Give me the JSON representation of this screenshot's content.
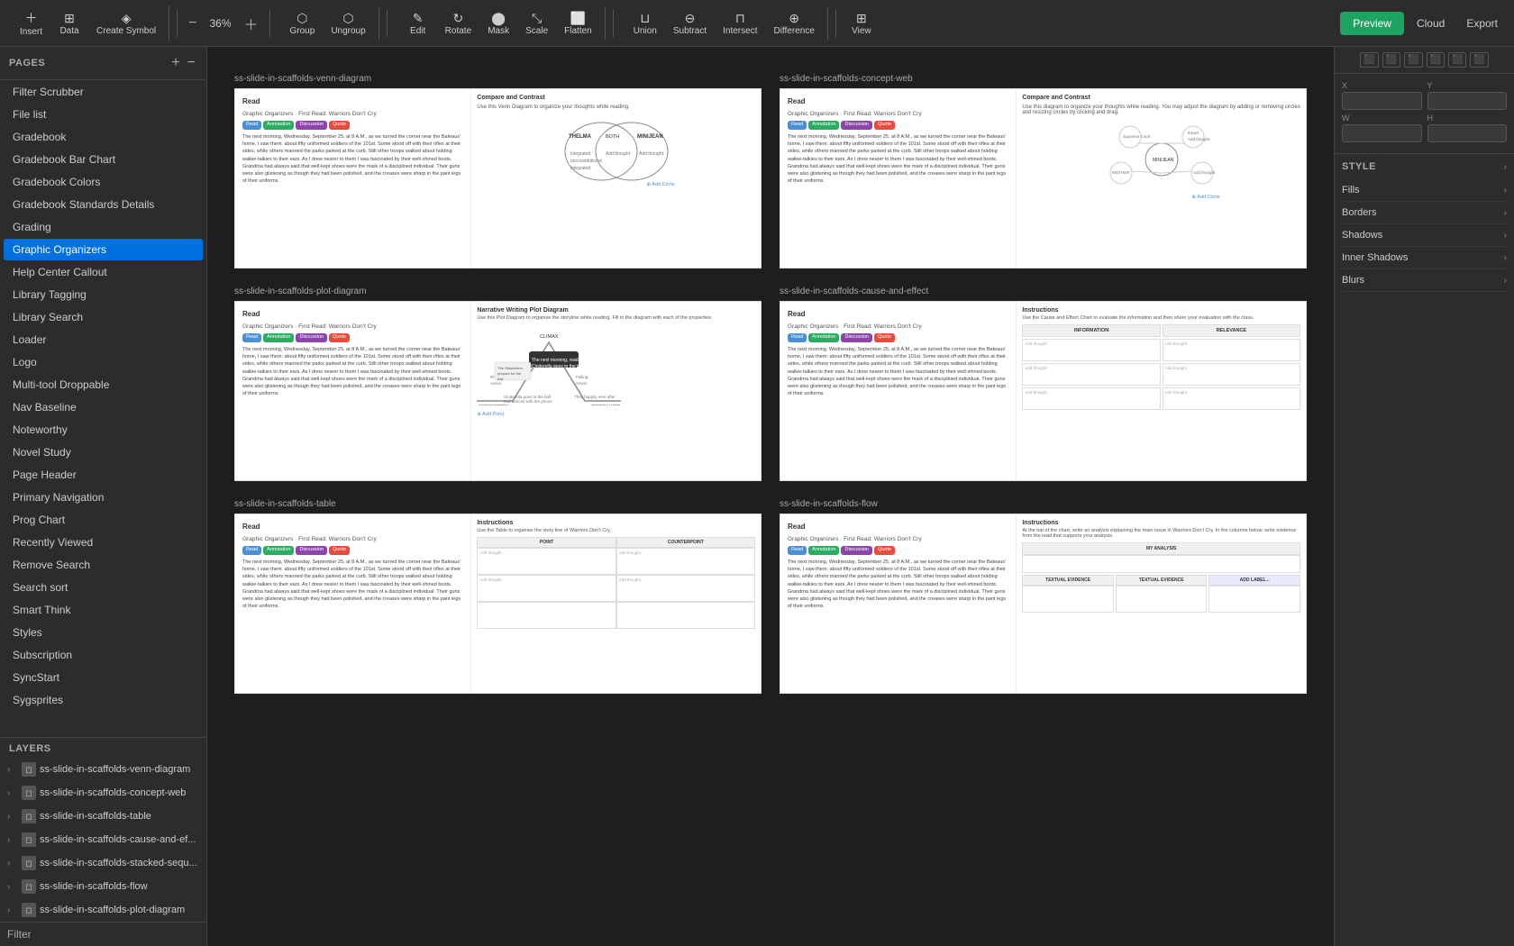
{
  "toolbar": {
    "insert_label": "Insert",
    "data_label": "Data",
    "create_symbol_label": "Create Symbol",
    "zoom_value": "36%",
    "group_label": "Group",
    "ungroup_label": "Ungroup",
    "edit_label": "Edit",
    "rotate_label": "Rotate",
    "mask_label": "Mask",
    "scale_label": "Scale",
    "flatten_label": "Flatten",
    "union_label": "Union",
    "subtract_label": "Subtract",
    "intersect_label": "Intersect",
    "difference_label": "Difference",
    "view_label": "View",
    "preview_label": "Preview",
    "cloud_label": "Cloud",
    "export_label": "Export"
  },
  "pages": {
    "title": "PAGES",
    "add_icon": "+",
    "collapse_icon": "−",
    "items": [
      {
        "label": "Filter Scrubber",
        "active": false
      },
      {
        "label": "File list",
        "active": false
      },
      {
        "label": "Gradebook",
        "active": false
      },
      {
        "label": "Gradebook Bar Chart",
        "active": false
      },
      {
        "label": "Gradebook Colors",
        "active": false
      },
      {
        "label": "Gradebook Standards Details",
        "active": false
      },
      {
        "label": "Grading",
        "active": false
      },
      {
        "label": "Graphic Organizers",
        "active": true
      },
      {
        "label": "Help Center Callout",
        "active": false
      },
      {
        "label": "Library Tagging",
        "active": false
      },
      {
        "label": "Library Search",
        "active": false
      },
      {
        "label": "Loader",
        "active": false
      },
      {
        "label": "Logo",
        "active": false
      },
      {
        "label": "Multi-tool Droppable",
        "active": false
      },
      {
        "label": "Nav Baseline",
        "active": false
      },
      {
        "label": "Noteworthy",
        "active": false
      },
      {
        "label": "Novel Study",
        "active": false
      },
      {
        "label": "Page Header",
        "active": false
      },
      {
        "label": "Primary Navigation",
        "active": false
      },
      {
        "label": "Prog Chart",
        "active": false
      },
      {
        "label": "Recently Viewed",
        "active": false
      },
      {
        "label": "Remove Search",
        "active": false
      },
      {
        "label": "Search sort",
        "active": false
      },
      {
        "label": "Smart Think",
        "active": false
      },
      {
        "label": "Styles",
        "active": false
      },
      {
        "label": "Subscription",
        "active": false
      },
      {
        "label": "SyncStart",
        "active": false
      },
      {
        "label": "Sygsprites",
        "active": false
      }
    ]
  },
  "layers": {
    "items": [
      {
        "label": "ss-slide-in-scaffolds-venn-diagram",
        "icon": "◻"
      },
      {
        "label": "ss-slide-in-scaffolds-concept-web",
        "icon": "◻"
      },
      {
        "label": "ss-slide-in-scaffolds-table",
        "icon": "◻"
      },
      {
        "label": "ss-slide-in-scaffolds-cause-and-ef...",
        "icon": "◻"
      },
      {
        "label": "ss-slide-in-scaffolds-stacked-sequ...",
        "icon": "◻"
      },
      {
        "label": "ss-slide-in-scaffolds-flow",
        "icon": "◻"
      },
      {
        "label": "ss-slide-in-scaffolds-plot-diagram",
        "icon": "◻"
      }
    ]
  },
  "canvas": {
    "rows": [
      {
        "items": [
          {
            "label": "ss-slide-in-scaffolds-venn-diagram",
            "type": "venn",
            "slide_subtitle": "Graphic Organizers · First Read: Warriors Don't Cry",
            "badges": [
              "Read",
              "Annotation",
              "Discussion",
              "Quote"
            ],
            "badge_colors": [
              "blue",
              "green",
              "purple",
              "orange"
            ]
          },
          {
            "label": "ss-slide-in-scaffolds-concept-web",
            "type": "concept-web",
            "slide_subtitle": "Graphic Organizers · First Read: Warriors Don't Cry",
            "badges": [
              "Read",
              "Annotation",
              "Discussion",
              "Quote"
            ]
          }
        ]
      },
      {
        "items": [
          {
            "label": "ss-slide-in-scaffolds-plot-diagram",
            "type": "plot",
            "slide_subtitle": "Graphic Organizers · First Read: Warriors Don't Cry",
            "badges": [
              "Read",
              "Annotation",
              "Discussion",
              "Quote"
            ]
          },
          {
            "label": "ss-slide-in-scaffolds-cause-and-effect",
            "type": "cause-effect",
            "slide_subtitle": "Graphic Organizers · First Read: Warriors Don't Cry",
            "badges": [
              "Read",
              "Annotation",
              "Discussion",
              "Quote"
            ]
          }
        ]
      },
      {
        "items": [
          {
            "label": "ss-slide-in-scaffolds-table",
            "type": "table",
            "slide_subtitle": "Graphic Organizers · First Read: Warriors Don't Cry",
            "badges": [
              "Read",
              "Annotation",
              "Discussion",
              "Quote"
            ]
          },
          {
            "label": "ss-slide-in-scaffolds-flow",
            "type": "flow",
            "slide_subtitle": "Graphic Organizers · First Read: Warriors Don't Cry",
            "badges": [
              "Read",
              "Annotation",
              "Discussion",
              "Quote"
            ]
          }
        ]
      }
    ]
  },
  "right_panel": {
    "x_label": "X",
    "y_label": "Y",
    "x_value": "",
    "y_value": "",
    "w_label": "W",
    "h_label": "H",
    "w_value": "",
    "h_value": "",
    "style_title": "STYLE",
    "fills_label": "Fills",
    "borders_label": "Borders",
    "shadows_label": "Shadows",
    "inner_shadows_label": "Inner Shadows",
    "blurs_label": "Blurs"
  },
  "slide_body": "The next morning, Wednesday, September 25, at 8 A.M., as we turned the corner near the Bateaus' home, I saw them: about fifty uniformed soldiers of the 101st. Some stood off with their rifles at their sides, while others manned the parks parked at the curb. Still other troops walked about holding walkie-talkies to their ears. As I drew nearer to them I was fascinated by their well-shined boots. Grandma had always said that well-kept shoes were the mark of a disciplined individual. Their guns were also glistening as though they had been polished, and the creases were sharp in the pant legs of their uniforms.",
  "filter_label": "Filter"
}
